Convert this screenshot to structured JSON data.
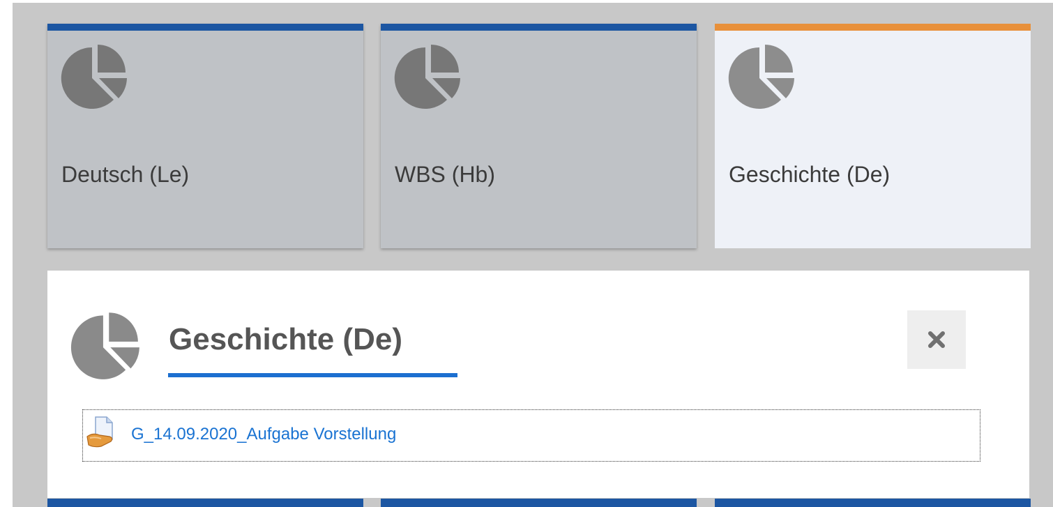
{
  "courses": [
    {
      "label": "Deutsch (Le)",
      "accent": "#1c56a2",
      "icon": "pie-chart-icon"
    },
    {
      "label": "WBS (Hb)",
      "accent": "#1c56a2",
      "icon": "pie-chart-icon"
    },
    {
      "label": "Geschichte (De)",
      "accent": "#e8903a",
      "icon": "pie-chart-icon",
      "selected": true
    }
  ],
  "panel": {
    "title": "Geschichte (De)",
    "icon": "pie-chart-icon",
    "close_icon": "close-icon",
    "files": [
      {
        "name": "G_14.09.2020_Aufgabe Vorstellung",
        "icon": "assignment-file-icon"
      }
    ]
  },
  "colors": {
    "accent_blue": "#1c56a2",
    "accent_orange": "#e8903a",
    "link_blue": "#1a73d2",
    "title_underline": "#1c6fd0"
  }
}
